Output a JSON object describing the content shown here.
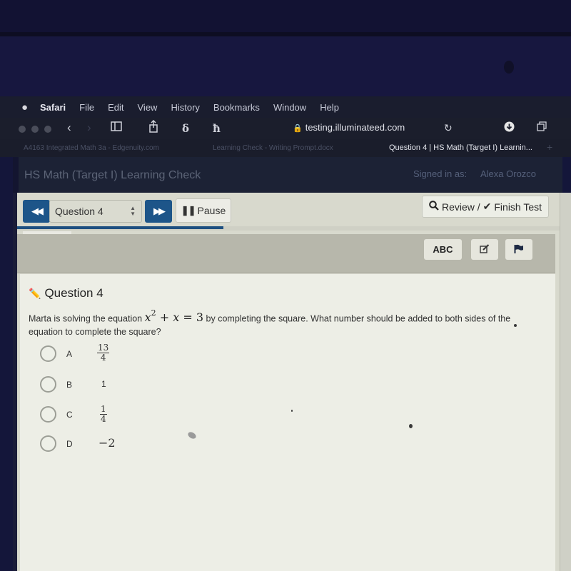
{
  "menubar": {
    "apple": "",
    "items": [
      "Safari",
      "File",
      "Edit",
      "View",
      "History",
      "Bookmarks",
      "Window",
      "Help"
    ]
  },
  "toolbar": {
    "url": "testing.illuminateed.com",
    "icons": [
      "back-icon",
      "forward-icon",
      "sidebar-icon",
      "share-icon",
      "extension-s-icon",
      "extension-k-icon",
      "reload-icon",
      "download-icon",
      "tabs-icon"
    ]
  },
  "tabs": [
    {
      "label": "A4163 Integrated Math 3a - Edgenuity.com",
      "active": false
    },
    {
      "label": "Learning Check - Writing Prompt.docx",
      "active": false
    },
    {
      "label": "Question 4 | HS Math (Target I) Learnin...",
      "active": true
    }
  ],
  "app": {
    "title": "HS Math (Target I) Learning Check",
    "signed_in_label": "Signed in as:",
    "user_name": "Alexa Orozco"
  },
  "nav": {
    "prev_icon": "double-chevron-left-icon",
    "next_icon": "double-chevron-right-icon",
    "question_select": "Question 4",
    "pause_label": "Pause",
    "review_label": "Review /",
    "finish_label": "Finish Test",
    "progress_percent": 38
  },
  "tools": {
    "abc_label": "ABC",
    "edit_icon": "edit-icon",
    "flag_icon": "flag-icon"
  },
  "question": {
    "heading": "Question 4",
    "text_before": "Marta is solving the equation",
    "equation": {
      "var": "x",
      "exp": "2",
      "plus": "+",
      "var2": "x",
      "eq": "=",
      "rhs": "3"
    },
    "text_after": "by completing the square. What number should be added to both sides of the equation to complete the square?",
    "choices": [
      {
        "letter": "A",
        "type": "fraction",
        "numerator": "13",
        "denominator": "4"
      },
      {
        "letter": "B",
        "type": "plain",
        "value": "1"
      },
      {
        "letter": "C",
        "type": "fraction",
        "numerator": "1",
        "denominator": "4"
      },
      {
        "letter": "D",
        "type": "big",
        "value": "−2"
      }
    ]
  }
}
